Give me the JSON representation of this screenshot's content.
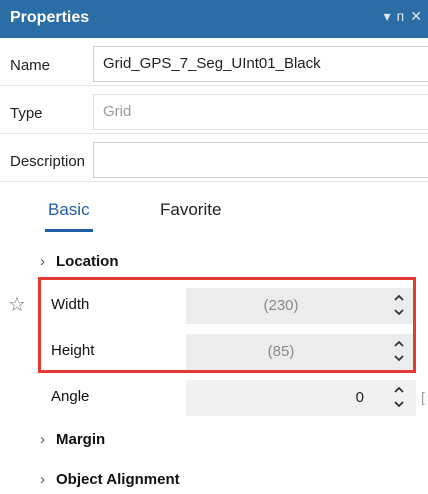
{
  "panel": {
    "title": "Properties",
    "controls": {
      "dropdown": "▾",
      "pin": "ᴨ",
      "close": "✕"
    }
  },
  "fields": {
    "name": {
      "label": "Name",
      "value": "Grid_GPS_7_Seg_UInt01_Black"
    },
    "type": {
      "label": "Type",
      "value": "Grid"
    },
    "description": {
      "label": "Description",
      "value": ""
    }
  },
  "tabs": {
    "basic": "Basic",
    "favorite": "Favorite",
    "active": "Basic"
  },
  "sections": {
    "location": "Location",
    "margin": "Margin",
    "object_alignment": "Object Alignment"
  },
  "properties": {
    "width": {
      "label": "Width",
      "value": "(230)"
    },
    "height": {
      "label": "Height",
      "value": "(85)"
    },
    "angle": {
      "label": "Angle",
      "value": "0"
    }
  },
  "icons": {
    "favorite_star": "star-outline-icon",
    "section_chevron": "chevron-right-icon",
    "spinner": "spin-up-down-icon"
  },
  "colors": {
    "titlebar": "#2b6ea6",
    "accent": "#1f5ea8",
    "highlight": "#e53935"
  }
}
